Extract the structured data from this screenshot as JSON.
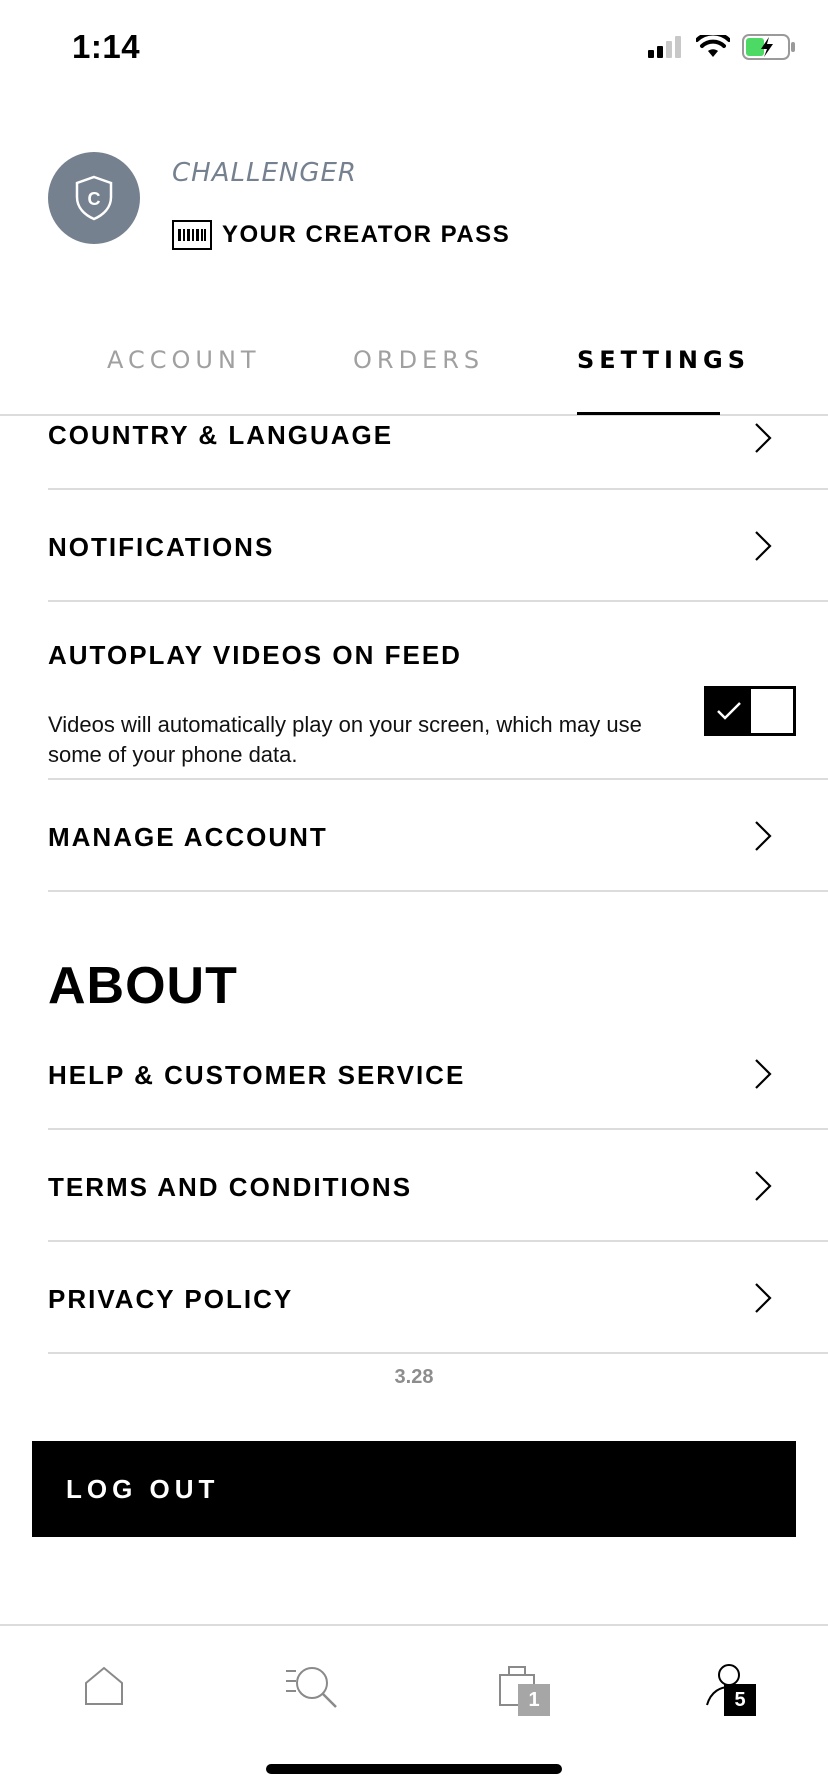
{
  "status_bar": {
    "time": "1:14"
  },
  "profile": {
    "avatar_initial": "C",
    "tier": "CHALLENGER",
    "creator_pass_label": "YOUR CREATOR PASS"
  },
  "tabs": [
    {
      "label": "ACCOUNT",
      "active": false
    },
    {
      "label": "ORDERS",
      "active": false
    },
    {
      "label": "SETTINGS",
      "active": true
    }
  ],
  "settings": {
    "country_language": "COUNTRY & LANGUAGE",
    "notifications": "NOTIFICATIONS",
    "autoplay": {
      "label": "AUTOPLAY VIDEOS ON FEED",
      "description": "Videos will automatically play on your screen, which may use some of your phone data.",
      "enabled": true
    },
    "manage_account": "MANAGE ACCOUNT"
  },
  "about": {
    "title": "ABOUT",
    "help": "HELP & CUSTOMER SERVICE",
    "terms": "TERMS AND CONDITIONS",
    "privacy": "PRIVACY POLICY"
  },
  "version": "3.28",
  "logout_label": "LOG OUT",
  "bottom_nav": {
    "items": [
      {
        "icon": "home-icon"
      },
      {
        "icon": "search-icon"
      },
      {
        "icon": "bag-icon",
        "badge": "1"
      },
      {
        "icon": "profile-icon",
        "badge": "5"
      }
    ]
  },
  "colors": {
    "avatar_bg": "#76818f",
    "divider": "#dcdcdc",
    "muted_text": "#a0a0a0",
    "version_text": "#8d8d8d",
    "bag_badge": "#a6a6a6",
    "profile_badge": "#000000"
  }
}
